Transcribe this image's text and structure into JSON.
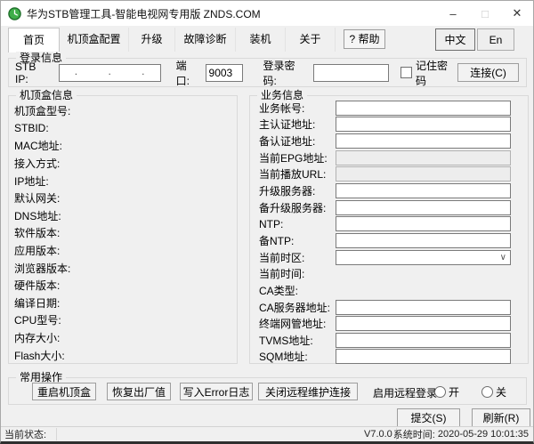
{
  "title_bar": {
    "title": "华为STB管理工具-智能电视网专用版 ZNDS.COM",
    "minimize": "–",
    "maximize": "□",
    "close": "✕"
  },
  "tabs": [
    {
      "id": "home",
      "label": "首页",
      "active": true
    },
    {
      "id": "stb-config",
      "label": "机顶盒配置",
      "active": false
    },
    {
      "id": "upgrade",
      "label": "升级",
      "active": false
    },
    {
      "id": "diagnosis",
      "label": "故障诊断",
      "active": false
    },
    {
      "id": "install",
      "label": "装机",
      "active": false
    },
    {
      "id": "about",
      "label": "关于",
      "active": false
    }
  ],
  "toolbar": {
    "help_label": "? 帮助",
    "lang_zh_label": "中文",
    "lang_en_label": "En"
  },
  "login": {
    "group_title": "登录信息",
    "stb_ip_label": "STB IP:",
    "ip_dots": [
      ".",
      ".",
      "."
    ],
    "port_label": "端口:",
    "port_value": "9003",
    "password_label": "登录密码:",
    "password_value": "",
    "remember_label": "记住密码",
    "connect_button": "连接(C)"
  },
  "stb_info": {
    "group_title": "机顶盒信息",
    "fields": [
      {
        "label": "机顶盒型号:",
        "value": ""
      },
      {
        "label": "STBID:",
        "value": ""
      },
      {
        "label": "MAC地址:",
        "value": ""
      },
      {
        "label": "接入方式:",
        "value": ""
      },
      {
        "label": "IP地址:",
        "value": ""
      },
      {
        "label": "默认网关:",
        "value": ""
      },
      {
        "label": "DNS地址:",
        "value": ""
      },
      {
        "label": "软件版本:",
        "value": ""
      },
      {
        "label": "应用版本:",
        "value": ""
      },
      {
        "label": "浏览器版本:",
        "value": ""
      },
      {
        "label": "硬件版本:",
        "value": ""
      },
      {
        "label": "编译日期:",
        "value": ""
      },
      {
        "label": "CPU型号:",
        "value": ""
      },
      {
        "label": "内存大小:",
        "value": ""
      },
      {
        "label": "Flash大小:",
        "value": ""
      }
    ]
  },
  "service_info": {
    "group_title": "业务信息",
    "fields": [
      {
        "id": "account",
        "label": "业务帐号:",
        "type": "input",
        "value": ""
      },
      {
        "id": "primary-auth",
        "label": "主认证地址:",
        "type": "input",
        "value": ""
      },
      {
        "id": "backup-auth",
        "label": "备认证地址:",
        "type": "input",
        "value": ""
      },
      {
        "id": "current-epg",
        "label": "当前EPG地址:",
        "type": "readonly",
        "value": ""
      },
      {
        "id": "current-play-url",
        "label": "当前播放URL:",
        "type": "readonly",
        "value": ""
      },
      {
        "id": "upgrade-server",
        "label": "升级服务器:",
        "type": "input",
        "value": ""
      },
      {
        "id": "backup-upgrade-server",
        "label": "备升级服务器:",
        "type": "input",
        "value": ""
      },
      {
        "id": "ntp",
        "label": "NTP:",
        "type": "input",
        "value": ""
      },
      {
        "id": "backup-ntp",
        "label": "备NTP:",
        "type": "input",
        "value": ""
      },
      {
        "id": "timezone",
        "label": "当前时区:",
        "type": "select",
        "value": ""
      },
      {
        "id": "current-time",
        "label": "当前时间:",
        "type": "label",
        "value": ""
      },
      {
        "id": "ca-type",
        "label": "CA类型:",
        "type": "label",
        "value": ""
      },
      {
        "id": "ca-server",
        "label": "CA服务器地址:",
        "type": "input",
        "value": ""
      },
      {
        "id": "terminal-nms",
        "label": "终端网管地址:",
        "type": "input",
        "value": ""
      },
      {
        "id": "tvms",
        "label": "TVMS地址:",
        "type": "input",
        "value": ""
      },
      {
        "id": "sqm",
        "label": "SQM地址:",
        "type": "input",
        "value": ""
      }
    ]
  },
  "common_ops": {
    "group_title": "常用操作",
    "buttons": [
      {
        "id": "reboot-stb",
        "label": "重启机顶盒"
      },
      {
        "id": "factory-reset",
        "label": "恢复出厂值"
      },
      {
        "id": "write-error-log",
        "label": "写入Error日志"
      },
      {
        "id": "close-remote-maintenance",
        "label": "关闭远程维护连接"
      }
    ],
    "remote_login_label": "启用远程登录:",
    "radio_on_label": "开",
    "radio_off_label": "关"
  },
  "footer": {
    "submit_button": "提交(S)",
    "refresh_button": "刷新(R)"
  },
  "status_bar": {
    "status_label": "当前状态:",
    "status_value": "",
    "version": "V7.0.0",
    "system_time_label": "系统时间:",
    "system_time_value": "2020-05-29 10:01:35"
  },
  "icons": {
    "chevron_down": "∨"
  },
  "colors": {
    "window_bg": "#f0f0f0",
    "titlebar_bg": "#ffffff",
    "app_icon_green": "#3fae49",
    "input_border": "#7a7a7a",
    "group_border": "#d9d9d9"
  }
}
